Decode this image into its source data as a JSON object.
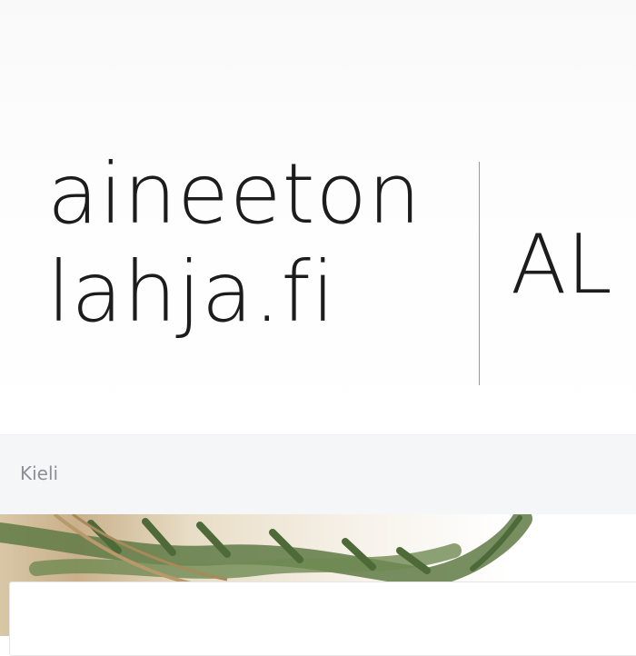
{
  "header": {
    "logo_line1": "aineeton",
    "logo_line2": "lahja.fi",
    "logo_right": "AL"
  },
  "language_bar": {
    "label": "Kieli"
  },
  "colors": {
    "header_bg": "#fbfbfb",
    "language_bar_bg": "#f5f6f8",
    "foliage": "#5f7a45",
    "twine": "#b89a6a"
  },
  "icons": {
    "hero": "evergreen-branch-with-twine"
  }
}
